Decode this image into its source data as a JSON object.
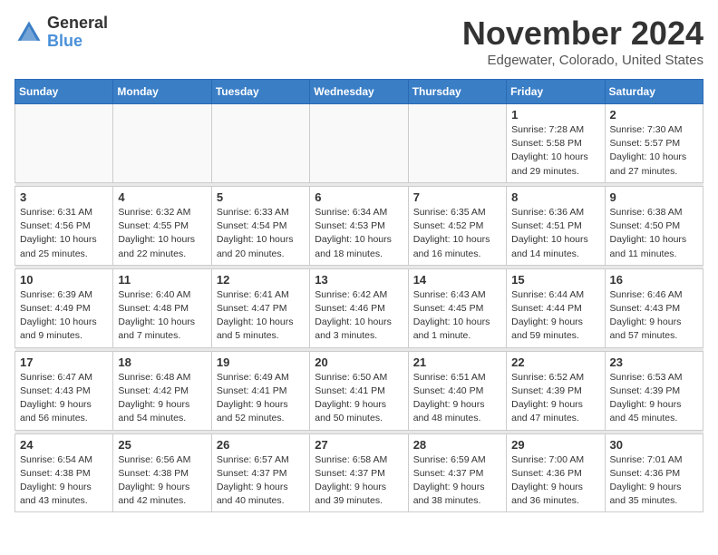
{
  "logo": {
    "general": "General",
    "blue": "Blue"
  },
  "title": "November 2024",
  "location": "Edgewater, Colorado, United States",
  "days_of_week": [
    "Sunday",
    "Monday",
    "Tuesday",
    "Wednesday",
    "Thursday",
    "Friday",
    "Saturday"
  ],
  "weeks": [
    [
      {
        "day": "",
        "info": ""
      },
      {
        "day": "",
        "info": ""
      },
      {
        "day": "",
        "info": ""
      },
      {
        "day": "",
        "info": ""
      },
      {
        "day": "",
        "info": ""
      },
      {
        "day": "1",
        "info": "Sunrise: 7:28 AM\nSunset: 5:58 PM\nDaylight: 10 hours\nand 29 minutes."
      },
      {
        "day": "2",
        "info": "Sunrise: 7:30 AM\nSunset: 5:57 PM\nDaylight: 10 hours\nand 27 minutes."
      }
    ],
    [
      {
        "day": "3",
        "info": "Sunrise: 6:31 AM\nSunset: 4:56 PM\nDaylight: 10 hours\nand 25 minutes."
      },
      {
        "day": "4",
        "info": "Sunrise: 6:32 AM\nSunset: 4:55 PM\nDaylight: 10 hours\nand 22 minutes."
      },
      {
        "day": "5",
        "info": "Sunrise: 6:33 AM\nSunset: 4:54 PM\nDaylight: 10 hours\nand 20 minutes."
      },
      {
        "day": "6",
        "info": "Sunrise: 6:34 AM\nSunset: 4:53 PM\nDaylight: 10 hours\nand 18 minutes."
      },
      {
        "day": "7",
        "info": "Sunrise: 6:35 AM\nSunset: 4:52 PM\nDaylight: 10 hours\nand 16 minutes."
      },
      {
        "day": "8",
        "info": "Sunrise: 6:36 AM\nSunset: 4:51 PM\nDaylight: 10 hours\nand 14 minutes."
      },
      {
        "day": "9",
        "info": "Sunrise: 6:38 AM\nSunset: 4:50 PM\nDaylight: 10 hours\nand 11 minutes."
      }
    ],
    [
      {
        "day": "10",
        "info": "Sunrise: 6:39 AM\nSunset: 4:49 PM\nDaylight: 10 hours\nand 9 minutes."
      },
      {
        "day": "11",
        "info": "Sunrise: 6:40 AM\nSunset: 4:48 PM\nDaylight: 10 hours\nand 7 minutes."
      },
      {
        "day": "12",
        "info": "Sunrise: 6:41 AM\nSunset: 4:47 PM\nDaylight: 10 hours\nand 5 minutes."
      },
      {
        "day": "13",
        "info": "Sunrise: 6:42 AM\nSunset: 4:46 PM\nDaylight: 10 hours\nand 3 minutes."
      },
      {
        "day": "14",
        "info": "Sunrise: 6:43 AM\nSunset: 4:45 PM\nDaylight: 10 hours\nand 1 minute."
      },
      {
        "day": "15",
        "info": "Sunrise: 6:44 AM\nSunset: 4:44 PM\nDaylight: 9 hours\nand 59 minutes."
      },
      {
        "day": "16",
        "info": "Sunrise: 6:46 AM\nSunset: 4:43 PM\nDaylight: 9 hours\nand 57 minutes."
      }
    ],
    [
      {
        "day": "17",
        "info": "Sunrise: 6:47 AM\nSunset: 4:43 PM\nDaylight: 9 hours\nand 56 minutes."
      },
      {
        "day": "18",
        "info": "Sunrise: 6:48 AM\nSunset: 4:42 PM\nDaylight: 9 hours\nand 54 minutes."
      },
      {
        "day": "19",
        "info": "Sunrise: 6:49 AM\nSunset: 4:41 PM\nDaylight: 9 hours\nand 52 minutes."
      },
      {
        "day": "20",
        "info": "Sunrise: 6:50 AM\nSunset: 4:41 PM\nDaylight: 9 hours\nand 50 minutes."
      },
      {
        "day": "21",
        "info": "Sunrise: 6:51 AM\nSunset: 4:40 PM\nDaylight: 9 hours\nand 48 minutes."
      },
      {
        "day": "22",
        "info": "Sunrise: 6:52 AM\nSunset: 4:39 PM\nDaylight: 9 hours\nand 47 minutes."
      },
      {
        "day": "23",
        "info": "Sunrise: 6:53 AM\nSunset: 4:39 PM\nDaylight: 9 hours\nand 45 minutes."
      }
    ],
    [
      {
        "day": "24",
        "info": "Sunrise: 6:54 AM\nSunset: 4:38 PM\nDaylight: 9 hours\nand 43 minutes."
      },
      {
        "day": "25",
        "info": "Sunrise: 6:56 AM\nSunset: 4:38 PM\nDaylight: 9 hours\nand 42 minutes."
      },
      {
        "day": "26",
        "info": "Sunrise: 6:57 AM\nSunset: 4:37 PM\nDaylight: 9 hours\nand 40 minutes."
      },
      {
        "day": "27",
        "info": "Sunrise: 6:58 AM\nSunset: 4:37 PM\nDaylight: 9 hours\nand 39 minutes."
      },
      {
        "day": "28",
        "info": "Sunrise: 6:59 AM\nSunset: 4:37 PM\nDaylight: 9 hours\nand 38 minutes."
      },
      {
        "day": "29",
        "info": "Sunrise: 7:00 AM\nSunset: 4:36 PM\nDaylight: 9 hours\nand 36 minutes."
      },
      {
        "day": "30",
        "info": "Sunrise: 7:01 AM\nSunset: 4:36 PM\nDaylight: 9 hours\nand 35 minutes."
      }
    ]
  ]
}
